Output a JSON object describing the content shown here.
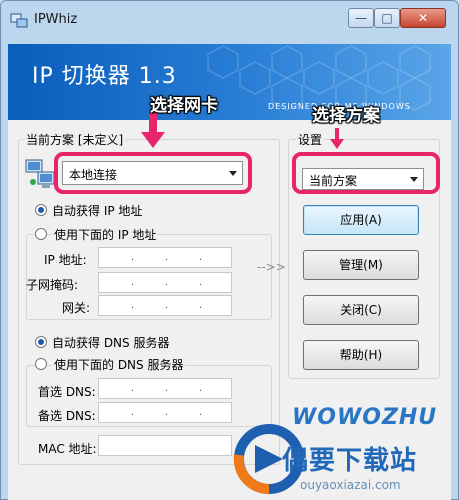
{
  "window": {
    "title": "IPWhiz",
    "minimize": "—",
    "maximize": "□",
    "close": "✕"
  },
  "banner": {
    "title": "IP 切换器 1.3",
    "subtitle": "DESIGNED FOR MS WINDOWS"
  },
  "left_group": {
    "legend": "当前方案 [未定义]",
    "network_select": "本地连接",
    "ip_auto": "自动获得 IP 地址",
    "ip_manual": "使用下面的 IP 地址",
    "ip_label": "IP 地址:",
    "mask_label": "子网掩码:",
    "gateway_label": "网关:",
    "dns_auto": "自动获得 DNS 服务器",
    "dns_manual": "使用下面的 DNS 服务器",
    "dns1_label": "首选 DNS:",
    "dns2_label": "备选 DNS:",
    "mac_label": "MAC 地址:"
  },
  "arrow_between": "-->>",
  "right_group": {
    "legend": "设置",
    "plan_select": "当前方案",
    "apply": "应用(A)",
    "manage": "管理(M)",
    "close": "关闭(C)",
    "help": "帮助(H)"
  },
  "annotations": {
    "select_nic": "选择网卡",
    "select_plan": "选择方案"
  },
  "watermark": {
    "brand": "WOWOZHU",
    "site": "偶要下载站",
    "url": "ouyaoxiazai.com"
  },
  "colors": {
    "highlight": "#e8256a",
    "banner": "#0a5dbb"
  }
}
